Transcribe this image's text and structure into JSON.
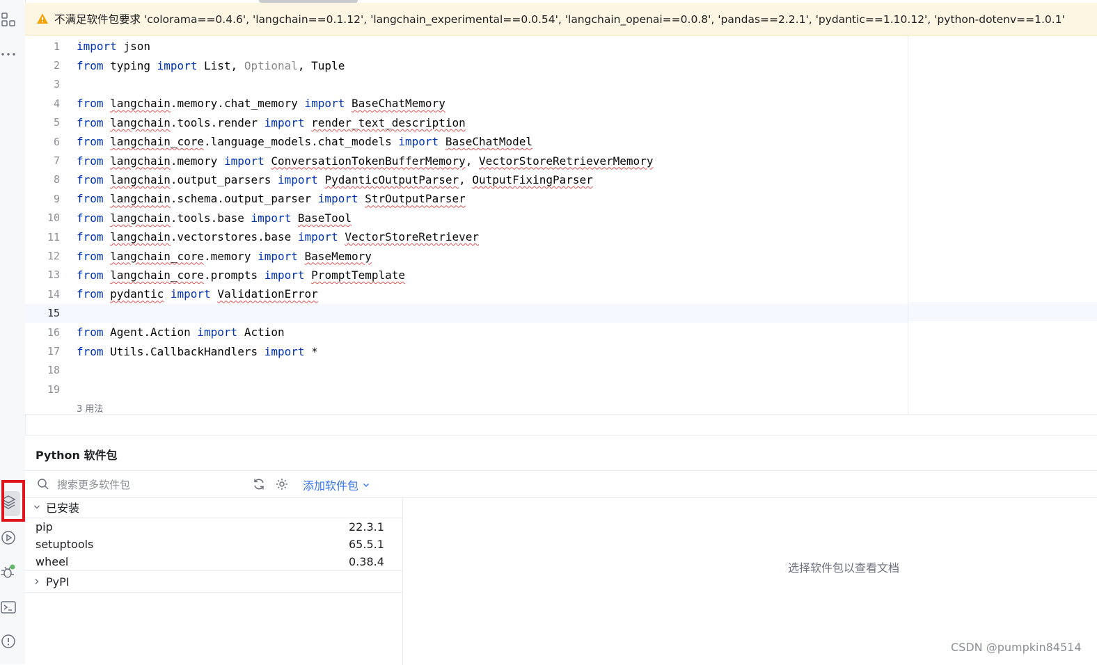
{
  "warning": {
    "text": "不满足软件包要求 'colorama==0.4.6', 'langchain==0.1.12', 'langchain_experimental==0.0.54', 'langchain_openai==0.0.8', 'pandas==2.2.1', 'pydantic==1.10.12', 'python-dotenv==1.0.1'",
    "icon": "warning-triangle-icon",
    "color": "#f2a40a"
  },
  "editor": {
    "current_line": 15,
    "usages_hint": "3 用法",
    "lines": [
      {
        "n": "1"
      },
      {
        "n": "2"
      },
      {
        "n": "3"
      },
      {
        "n": "4"
      },
      {
        "n": "5"
      },
      {
        "n": "6"
      },
      {
        "n": "7"
      },
      {
        "n": "8"
      },
      {
        "n": "9"
      },
      {
        "n": "10"
      },
      {
        "n": "11"
      },
      {
        "n": "12"
      },
      {
        "n": "13"
      },
      {
        "n": "14"
      },
      {
        "n": "15"
      },
      {
        "n": "16"
      },
      {
        "n": "17"
      },
      {
        "n": "18"
      },
      {
        "n": "19"
      }
    ],
    "code": {
      "l1_kw": "import",
      "l1_rest": " json",
      "l2_kw1": "from",
      "l2_a": " typing ",
      "l2_kw2": "import",
      "l2_b": " List, ",
      "l2_dim": "Optional",
      "l2_c": ", Tuple",
      "l4_mod": "langchain",
      "l4_path": ".memory.chat_memory ",
      "l4_name": "BaseChatMemory",
      "l5_mod": "langchain",
      "l5_path": ".tools.render ",
      "l5_name": "render_text_description",
      "l6_mod": "langchain_core",
      "l6_path": ".language_models.chat_models ",
      "l6_name": "BaseChatModel",
      "l7_mod": "langchain",
      "l7_path": ".memory ",
      "l7_name": "ConversationTokenBufferMemory",
      "l7_sep": ", ",
      "l7_name2": "VectorStoreRetrieverMemory",
      "l8_mod": "langchain",
      "l8_path": ".output_parsers ",
      "l8_name": "PydanticOutputParser",
      "l8_sep": ", ",
      "l8_name2": "OutputFixingParser",
      "l9_mod": "langchain",
      "l9_path": ".schema.output_parser ",
      "l9_name": "StrOutputParser",
      "l10_mod": "langchain",
      "l10_path": ".tools.base ",
      "l10_name": "BaseTool",
      "l11_mod": "langchain",
      "l11_path": ".vectorstores.base ",
      "l11_name": "VectorStoreRetriever",
      "l12_mod": "langchain_core",
      "l12_path": ".memory ",
      "l12_name": "BaseMemory",
      "l13_mod": "langchain_core",
      "l13_path": ".prompts ",
      "l13_name": "PromptTemplate",
      "l14_mod": "pydantic",
      "l14_path": " ",
      "l14_name": "ValidationError",
      "l16_path": " Agent.Action ",
      "l16_name": " Action",
      "l17_path": " Utils.CallbackHandlers ",
      "l17_name": " *",
      "kw_from": "from",
      "kw_import": "import"
    }
  },
  "packages_panel": {
    "title": "Python 软件包",
    "search_placeholder": "搜索更多软件包",
    "add_package_label": "添加软件包",
    "installed_label": "已安装",
    "installed": [
      {
        "name": "pip",
        "version": "22.3.1"
      },
      {
        "name": "setuptools",
        "version": "65.5.1"
      },
      {
        "name": "wheel",
        "version": "0.38.4"
      }
    ],
    "pypi_label": "PyPI",
    "doc_placeholder": "选择软件包以查看文档"
  },
  "watermark": "CSDN @pumpkin84514",
  "colors": {
    "keyword": "#0033b3",
    "link": "#3574f0",
    "highlight": "#e0141b"
  }
}
